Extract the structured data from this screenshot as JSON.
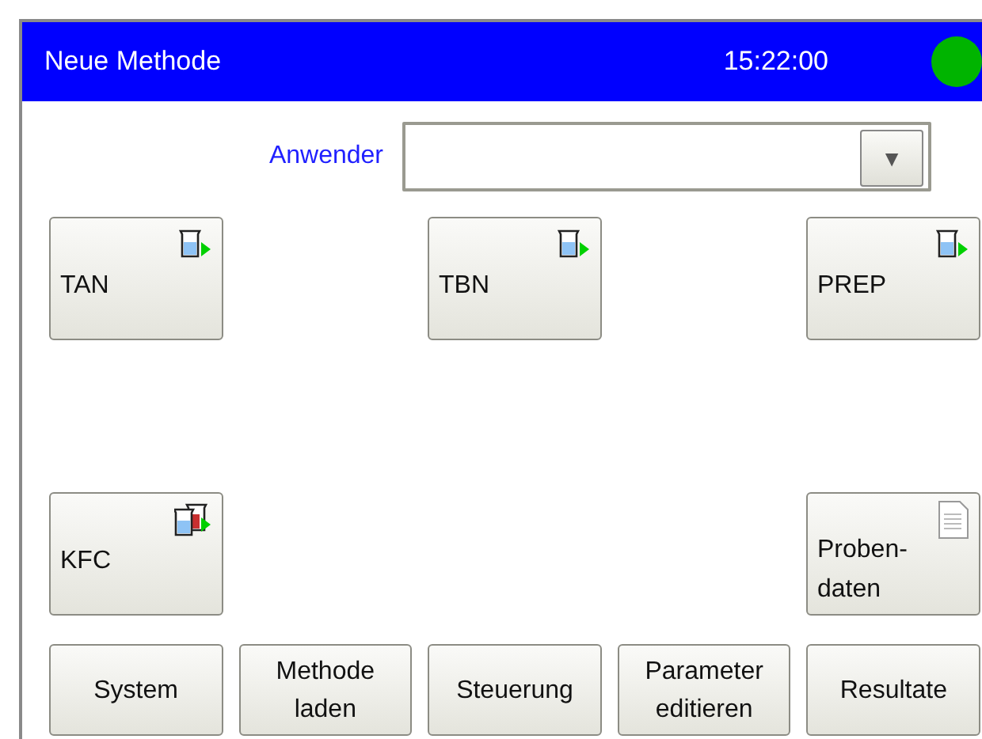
{
  "header": {
    "title": "Neue Methode",
    "time": "15:22:00",
    "ready": true
  },
  "user_field": {
    "label": "Anwender",
    "dropdown_arrow": "▼"
  },
  "tile_rows": [
    [
      {
        "label": "TAN",
        "kind": "beaker"
      },
      {
        "label": "TBN",
        "kind": "beaker"
      },
      {
        "label": "PREP",
        "kind": "beaker"
      }
    ],
    [
      {
        "label": "KFC",
        "kind": "beakers"
      },
      {
        "label": "Proben-\ndaten",
        "kind": "document"
      }
    ]
  ],
  "bottom_buttons": [
    "System",
    "Methode\nladen",
    "Steuerung",
    "Parameter\neditieren",
    "Resultate"
  ]
}
